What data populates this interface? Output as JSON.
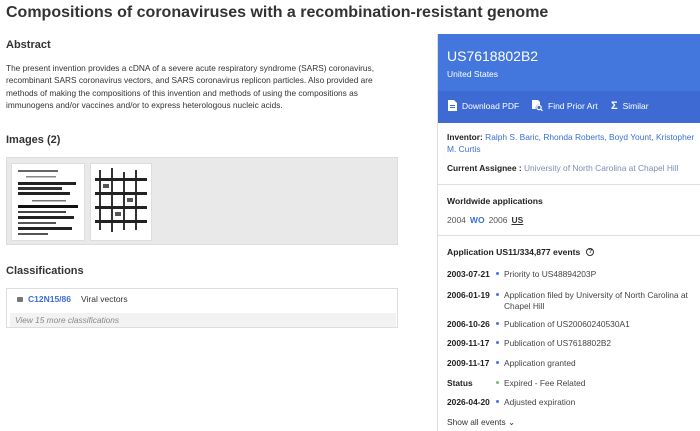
{
  "title": "Compositions of coronaviruses with a recombination-resistant genome",
  "abstract": {
    "heading": "Abstract",
    "text": "The present invention provides a cDNA of a severe acute respiratory syndrome (SARS) coronavirus, recombinant SARS coronavirus vectors, and SARS coronavirus replicon particles. Also provided are methods of making the compositions of this invention and methods of using the compositions as immunogens and/or vaccines and/or to express heterologous nucleic acids."
  },
  "images": {
    "heading": "Images (2)"
  },
  "classifications": {
    "heading": "Classifications",
    "code": "C12N15/86",
    "description": "Viral vectors",
    "more": "View 15 more classifications"
  },
  "patent": {
    "number": "US7618802B2",
    "country": "United States",
    "actions": {
      "download": "Download PDF",
      "prior_art": "Find Prior Art",
      "similar": "Similar"
    },
    "inventor_label": "Inventor:",
    "inventors": "Ralph S. Baric, Rhonda Roberts, Boyd Yount, Kristopher M. Curtis",
    "assignee_label": "Current Assignee :",
    "assignee": "University of North Carolina at Chapel Hill"
  },
  "worldwide": {
    "heading": "Worldwide applications",
    "y1": "2004",
    "c1": "WO",
    "y2": "2006",
    "c2": "US"
  },
  "events": {
    "heading": "Application US11/334,877 events",
    "items": [
      {
        "date": "2003-07-21",
        "text": "Priority to US48894203P"
      },
      {
        "date": "2006-01-19",
        "text": "Application filed by University of North Carolina at Chapel Hill"
      },
      {
        "date": "2006-10-26",
        "text": "Publication of US20060240530A1"
      },
      {
        "date": "2009-11-17",
        "text": "Publication of US7618802B2"
      },
      {
        "date": "2009-11-17",
        "text": "Application granted"
      },
      {
        "date": "Status",
        "text": "Expired - Fee Related"
      },
      {
        "date": "2026-04-20",
        "text": "Adjusted expiration"
      }
    ],
    "show_all": "Show all events ⌄"
  },
  "colors": {
    "header_blue": "#4477dd",
    "action_blue": "#3d6bd3",
    "link": "#3b6fd4",
    "status_green": "#6fbf73"
  }
}
